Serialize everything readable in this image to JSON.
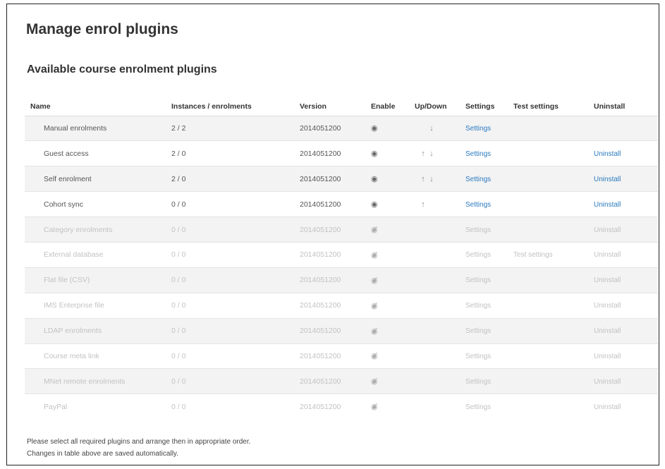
{
  "page": {
    "title": "Manage enrol plugins",
    "section_title": "Available course enrolment plugins"
  },
  "table": {
    "headers": [
      "Name",
      "Instances / enrolments",
      "Version",
      "Enable",
      "Up/Down",
      "Settings",
      "Test settings",
      "Uninstall"
    ],
    "rows": [
      {
        "name": "Manual enrolments",
        "instances": "2 / 2",
        "version": "2014051200",
        "enabled": true,
        "up": false,
        "down": true,
        "settings": "Settings",
        "test_settings": "",
        "uninstall": ""
      },
      {
        "name": "Guest access",
        "instances": "2 / 0",
        "version": "2014051200",
        "enabled": true,
        "up": true,
        "down": true,
        "settings": "Settings",
        "test_settings": "",
        "uninstall": "Uninstall"
      },
      {
        "name": "Self enrolment",
        "instances": "2 / 0",
        "version": "2014051200",
        "enabled": true,
        "up": true,
        "down": true,
        "settings": "Settings",
        "test_settings": "",
        "uninstall": "Uninstall"
      },
      {
        "name": "Cohort sync",
        "instances": "0 / 0",
        "version": "2014051200",
        "enabled": true,
        "up": true,
        "down": false,
        "settings": "Settings",
        "test_settings": "",
        "uninstall": "Uninstall"
      },
      {
        "name": "Category enrolments",
        "instances": "0 / 0",
        "version": "2014051200",
        "enabled": false,
        "up": false,
        "down": false,
        "settings": "Settings",
        "test_settings": "",
        "uninstall": "Uninstall"
      },
      {
        "name": "External database",
        "instances": "0 / 0",
        "version": "2014051200",
        "enabled": false,
        "up": false,
        "down": false,
        "settings": "Settings",
        "test_settings": "Test settings",
        "uninstall": "Uninstall"
      },
      {
        "name": "Flat file (CSV)",
        "instances": "0 / 0",
        "version": "2014051200",
        "enabled": false,
        "up": false,
        "down": false,
        "settings": "Settings",
        "test_settings": "",
        "uninstall": "Uninstall"
      },
      {
        "name": "IMS Enterprise file",
        "instances": "0 / 0",
        "version": "2014051200",
        "enabled": false,
        "up": false,
        "down": false,
        "settings": "Settings",
        "test_settings": "",
        "uninstall": "Uninstall"
      },
      {
        "name": "LDAP enrolments",
        "instances": "0 / 0",
        "version": "2014051200",
        "enabled": false,
        "up": false,
        "down": false,
        "settings": "Settings",
        "test_settings": "",
        "uninstall": "Uninstall"
      },
      {
        "name": "Course meta link",
        "instances": "0 / 0",
        "version": "2014051200",
        "enabled": false,
        "up": false,
        "down": false,
        "settings": "Settings",
        "test_settings": "",
        "uninstall": "Uninstall"
      },
      {
        "name": "MNet remote enrolments",
        "instances": "0 / 0",
        "version": "2014051200",
        "enabled": false,
        "up": false,
        "down": false,
        "settings": "Settings",
        "test_settings": "",
        "uninstall": "Uninstall"
      },
      {
        "name": "PayPal",
        "instances": "0 / 0",
        "version": "2014051200",
        "enabled": false,
        "up": false,
        "down": false,
        "settings": "Settings",
        "test_settings": "",
        "uninstall": "Uninstall"
      }
    ]
  },
  "footer": {
    "line1": "Please select all required plugins and arrange then in appropriate order.",
    "line2": "Changes in table above are saved automatically."
  },
  "icons": {
    "enabled": "eye-icon",
    "disabled": "eye-off-icon",
    "up": "arrow-up-icon",
    "down": "arrow-down-icon"
  },
  "colors": {
    "link": "#2a7abf",
    "disabled_text": "#c2c2c2",
    "row_stripe": "#f3f3f3"
  }
}
